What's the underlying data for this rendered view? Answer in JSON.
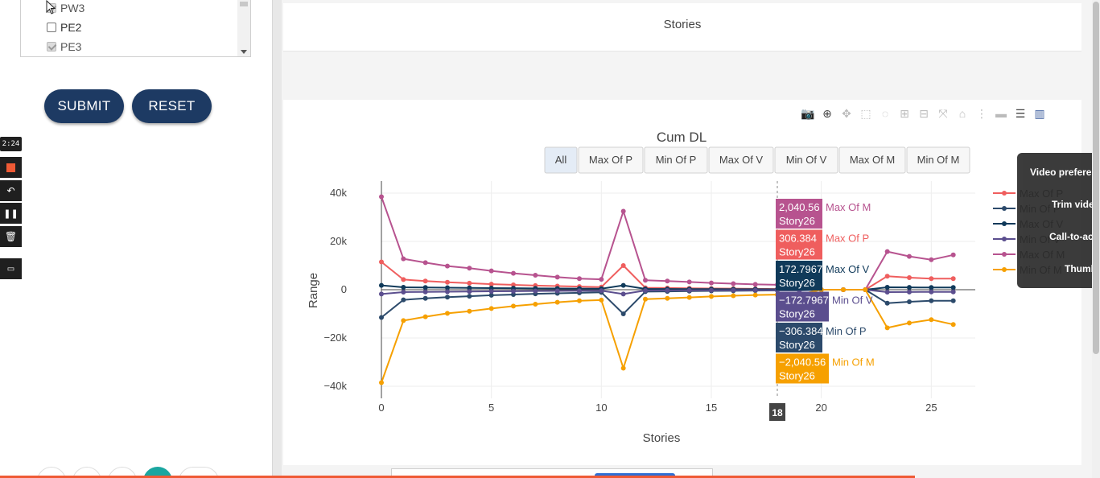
{
  "sidebar": {
    "list_items": [
      {
        "label": "PW3",
        "checked": true,
        "disabled": true
      },
      {
        "label": "PE2",
        "checked": false,
        "disabled": false
      },
      {
        "label": "PE3",
        "checked": true,
        "disabled": true
      }
    ],
    "submit_label": "SUBMIT",
    "reset_label": "RESET"
  },
  "recorder": {
    "time": "2:24"
  },
  "top_card": {
    "caption": "Stories"
  },
  "buttons": [
    "All",
    "Max Of P",
    "Min Of P",
    "Max Of V",
    "Min Of V",
    "Max Of M",
    "Min Of M"
  ],
  "active_button": "All",
  "preferences": {
    "items": [
      "Video preferences",
      "Trim video",
      "Call-to-action",
      "Thumbnail"
    ]
  },
  "chart_data": {
    "type": "line",
    "title": "Cum DL",
    "xlabel": "Stories",
    "ylabel": "Range",
    "xlim": [
      0,
      27
    ],
    "ylim": [
      -45000,
      45000
    ],
    "x_ticks": [
      0,
      5,
      10,
      15,
      20,
      25
    ],
    "y_ticks": [
      {
        "v": 40000,
        "label": "40k"
      },
      {
        "v": 20000,
        "label": "20k"
      },
      {
        "v": 0,
        "label": "0"
      },
      {
        "v": -20000,
        "label": "−20k"
      },
      {
        "v": -40000,
        "label": "−40k"
      }
    ],
    "x": [
      0,
      1,
      2,
      3,
      4,
      5,
      6,
      7,
      8,
      9,
      10,
      11,
      12,
      13,
      14,
      15,
      16,
      17,
      18,
      19,
      20,
      21,
      22,
      23,
      24,
      25,
      26
    ],
    "hover_x": 18,
    "hover_x_label": "18",
    "series": [
      {
        "name": "Max Of P",
        "color": "#ef5e5e",
        "values": [
          11500,
          4200,
          3600,
          3100,
          2700,
          2300,
          2000,
          1700,
          1500,
          1300,
          1100,
          10000,
          800,
          700,
          600,
          520,
          450,
          380,
          306,
          300,
          0,
          0,
          0,
          5600,
          5000,
          4600,
          4600
        ]
      },
      {
        "name": "Min Of P",
        "color": "#2c4a6b",
        "values": [
          -11500,
          -4200,
          -3600,
          -3100,
          -2700,
          -2300,
          -2000,
          -1700,
          -1500,
          -1300,
          -1100,
          -10000,
          -800,
          -700,
          -600,
          -520,
          -450,
          -380,
          -306,
          -300,
          0,
          0,
          0,
          -5600,
          -5000,
          -4600,
          -4600
        ]
      },
      {
        "name": "Max Of V",
        "color": "#103a5a",
        "values": [
          1800,
          1000,
          900,
          820,
          750,
          680,
          620,
          560,
          500,
          440,
          400,
          1800,
          330,
          300,
          270,
          240,
          210,
          190,
          173,
          170,
          0,
          0,
          0,
          1000,
          950,
          900,
          900
        ]
      },
      {
        "name": "Min Of V",
        "color": "#5b4e8e",
        "values": [
          -1800,
          -1000,
          -900,
          -820,
          -750,
          -680,
          -620,
          -560,
          -500,
          -440,
          -400,
          -1800,
          -330,
          -300,
          -270,
          -240,
          -210,
          -190,
          -173,
          -170,
          0,
          0,
          0,
          -1000,
          -950,
          -900,
          -900
        ]
      },
      {
        "name": "Max Of M",
        "color": "#b7538f",
        "values": [
          38500,
          12800,
          11200,
          9800,
          8900,
          7800,
          6800,
          6000,
          5200,
          4600,
          4300,
          32500,
          3900,
          3600,
          3200,
          2800,
          2500,
          2200,
          2040,
          2000,
          0,
          0,
          0,
          15800,
          13800,
          12400,
          14400
        ]
      },
      {
        "name": "Min Of M",
        "color": "#f6a000",
        "values": [
          -38500,
          -12800,
          -11200,
          -9800,
          -8900,
          -7800,
          -6800,
          -6000,
          -5200,
          -4600,
          -4300,
          -32500,
          -3900,
          -3600,
          -3200,
          -2800,
          -2500,
          -2200,
          -2040,
          -2000,
          0,
          0,
          0,
          -15800,
          -13800,
          -12400,
          -14400
        ]
      }
    ],
    "hover_labels": [
      {
        "value": "2,040.56",
        "name": "Max Of M",
        "story": "Story26",
        "bg": "#b7538f",
        "text_color": "#b7538f"
      },
      {
        "value": "306.384",
        "name": "Max Of P",
        "story": "Story26",
        "bg": "#ef5e5e",
        "text_color": "#ef5e5e"
      },
      {
        "value": "172.7967",
        "name": "Max Of V",
        "story": "Story26",
        "bg": "#103a5a",
        "text_color": "#103a5a"
      },
      {
        "value": "−172.7967",
        "name": "Min Of V",
        "story": "Story26",
        "bg": "#5b4e8e",
        "text_color": "#5b4e8e"
      },
      {
        "value": "−306.384",
        "name": "Min Of P",
        "story": "Story26",
        "bg": "#2c4a6b",
        "text_color": "#2c4a6b"
      },
      {
        "value": "−2,040.56",
        "name": "Min Of M",
        "story": "Story26",
        "bg": "#f6a000",
        "text_color": "#f6a000"
      }
    ],
    "legend_position": "right"
  }
}
